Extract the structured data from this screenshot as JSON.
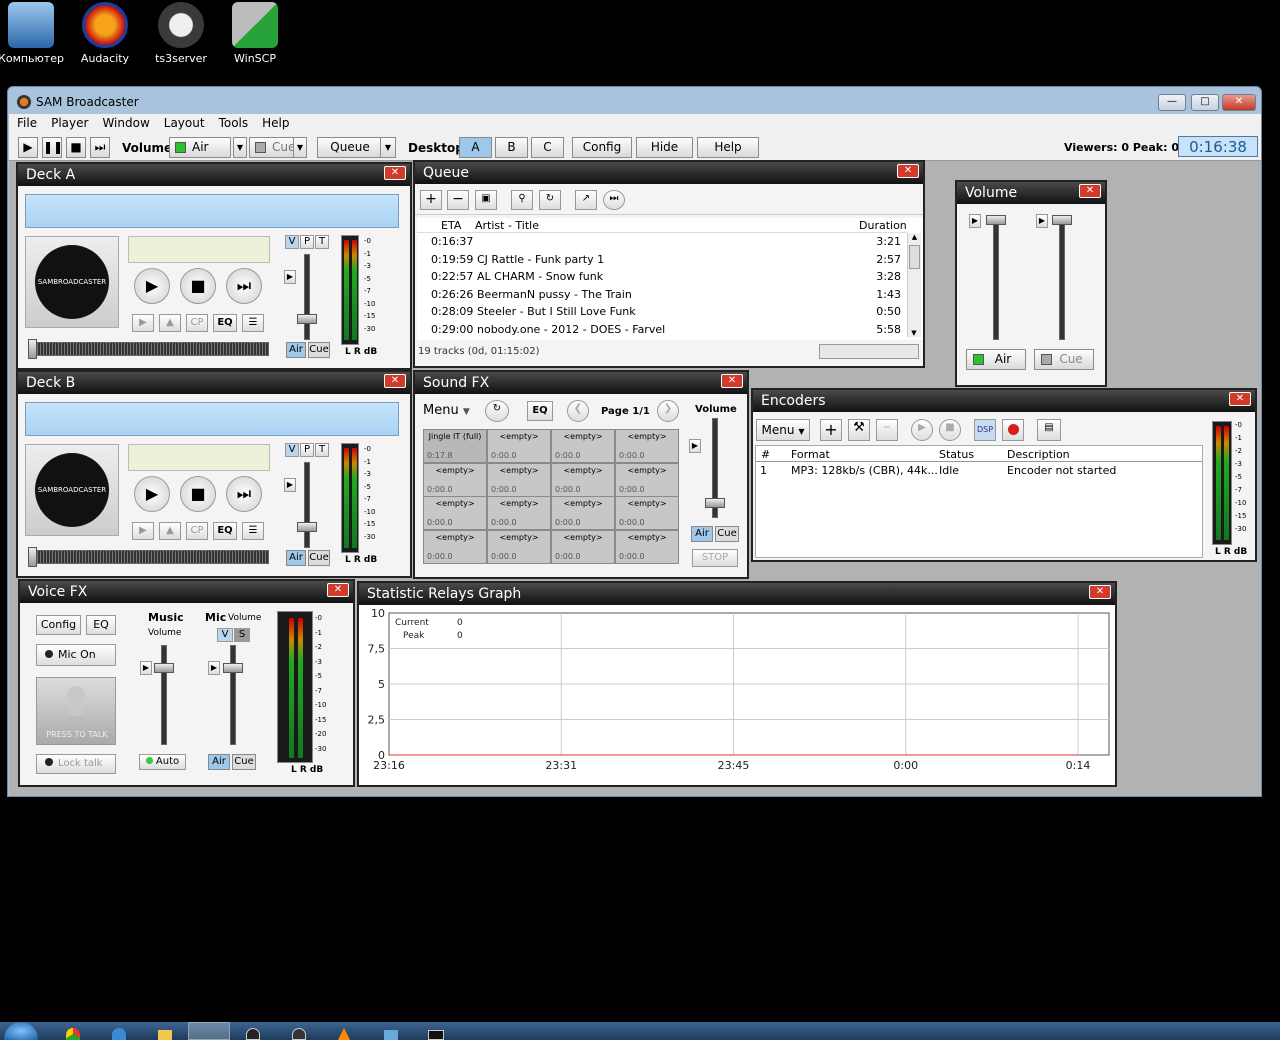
{
  "desktop": {
    "icons": [
      {
        "label": "Компьютер",
        "icon": "computer-icon"
      },
      {
        "label": "Audacity",
        "icon": "audacity-icon"
      },
      {
        "label": "ts3server",
        "icon": "ts3server-icon"
      },
      {
        "label": "WinSCP",
        "icon": "winscp-icon"
      }
    ]
  },
  "window": {
    "title": "SAM Broadcaster",
    "menu": [
      "File",
      "Player",
      "Window",
      "Layout",
      "Tools",
      "Help"
    ]
  },
  "toolbar": {
    "volume_label": "Volume",
    "air": "Air",
    "cue": "Cue",
    "queue": "Queue",
    "desktop_label": "Desktop",
    "desktops": [
      "A",
      "B",
      "C"
    ],
    "config": "Config",
    "hide": "Hide",
    "help": "Help",
    "viewers": "Viewers: 0  Peak: 0",
    "clock": "0:16:38"
  },
  "deckA": {
    "title": "Deck A",
    "logo": "SAMBROADCASTER",
    "vpt": [
      "V",
      "P",
      "T"
    ],
    "buttons": [
      "CP",
      "EQ"
    ],
    "air": "Air",
    "cue": "Cue",
    "meter_scale": [
      "-0",
      "-1",
      "-3",
      "-5",
      "-7",
      "-10",
      "-15",
      "-30"
    ],
    "meter_label": "L R dB"
  },
  "deckB": {
    "title": "Deck B",
    "logo": "SAMBROADCASTER",
    "vpt": [
      "V",
      "P",
      "T"
    ],
    "buttons": [
      "CP",
      "EQ"
    ],
    "air": "Air",
    "cue": "Cue",
    "meter_scale": [
      "-0",
      "-1",
      "-3",
      "-5",
      "-7",
      "-10",
      "-15",
      "-30"
    ],
    "meter_label": "L R dB"
  },
  "queue": {
    "title": "Queue",
    "columns": [
      "ETA",
      "Artist - Title",
      "Duration"
    ],
    "rows": [
      {
        "eta": "0:16:37",
        "title": "",
        "duration": "3:21"
      },
      {
        "eta": "0:19:59",
        "title": "CJ Rattle - Funk party 1",
        "duration": "2:57"
      },
      {
        "eta": "0:22:57",
        "title": "AL CHARM - Snow funk",
        "duration": "3:28"
      },
      {
        "eta": "0:26:26",
        "title": "BeermanN pussy - The Train",
        "duration": "1:43"
      },
      {
        "eta": "0:28:09",
        "title": "Steeler - But I Still Love Funk",
        "duration": "0:50"
      },
      {
        "eta": "0:29:00",
        "title": "nobody.one - 2012 - DOES - Farvel",
        "duration": "5:58"
      }
    ],
    "status": "19 tracks (0d, 01:15:02)"
  },
  "volume": {
    "title": "Volume",
    "air": "Air",
    "cue": "Cue"
  },
  "soundfx": {
    "title": "Sound FX",
    "menu": "Menu",
    "eq": "EQ",
    "page": "Page 1/1",
    "volume": "Volume",
    "air": "Air",
    "cue": "Cue",
    "stop": "STOP",
    "cells": [
      {
        "name": "Jingle IT (full)",
        "time": "0:17.8"
      },
      {
        "name": "<empty>",
        "time": "0:00.0"
      },
      {
        "name": "<empty>",
        "time": "0:00.0"
      },
      {
        "name": "<empty>",
        "time": "0:00.0"
      },
      {
        "name": "<empty>",
        "time": "0:00.0"
      },
      {
        "name": "<empty>",
        "time": "0:00.0"
      },
      {
        "name": "<empty>",
        "time": "0:00.0"
      },
      {
        "name": "<empty>",
        "time": "0:00.0"
      },
      {
        "name": "<empty>",
        "time": "0:00.0"
      },
      {
        "name": "<empty>",
        "time": "0:00.0"
      },
      {
        "name": "<empty>",
        "time": "0:00.0"
      },
      {
        "name": "<empty>",
        "time": "0:00.0"
      },
      {
        "name": "<empty>",
        "time": "0:00.0"
      },
      {
        "name": "<empty>",
        "time": "0:00.0"
      },
      {
        "name": "<empty>",
        "time": "0:00.0"
      },
      {
        "name": "<empty>",
        "time": "0:00.0"
      }
    ]
  },
  "encoders": {
    "title": "Encoders",
    "menu": "Menu",
    "dsp": "DSP",
    "columns": [
      "#",
      "Format",
      "Status",
      "Description"
    ],
    "rows": [
      {
        "num": "1",
        "format": "MP3: 128kb/s (CBR), 44k...",
        "status": "Idle",
        "description": "Encoder not started"
      }
    ],
    "meter_scale": [
      "-0",
      "-1",
      "-2",
      "-3",
      "-5",
      "-7",
      "-10",
      "-15",
      "-30"
    ],
    "meter_label": "L R dB"
  },
  "voicefx": {
    "title": "Voice FX",
    "config": "Config",
    "eq": "EQ",
    "mic_on": "Mic On",
    "press_to_talk": "PRESS TO TALK",
    "lock_talk": "Lock talk",
    "music": "Music",
    "music_volume": "Volume",
    "mic": "Mic",
    "mic_volume": "Volume",
    "v": "V",
    "s": "S",
    "auto": "Auto",
    "air": "Air",
    "cue": "Cue",
    "meter_scale": [
      "-0",
      "-1",
      "-2",
      "-3",
      "-5",
      "-7",
      "-10",
      "-15",
      "-20",
      "-30"
    ],
    "meter_label": "L R dB"
  },
  "stats": {
    "title": "Statistic Relays Graph",
    "legend_current": "Current",
    "legend_current_value": "0",
    "legend_peak": "Peak",
    "legend_peak_value": "0"
  },
  "chart_data": {
    "type": "line",
    "title": "",
    "x": [
      "23:16",
      "23:31",
      "23:45",
      "0:00",
      "0:14"
    ],
    "y_ticks": [
      "0",
      "2,5",
      "5",
      "7,5",
      "10"
    ],
    "ylim": [
      0,
      10
    ],
    "grid": true,
    "series": [
      {
        "name": "Current",
        "values": [
          0,
          0,
          0,
          0,
          0
        ]
      },
      {
        "name": "Peak",
        "values": [
          0,
          0,
          0,
          0,
          0
        ]
      }
    ]
  }
}
